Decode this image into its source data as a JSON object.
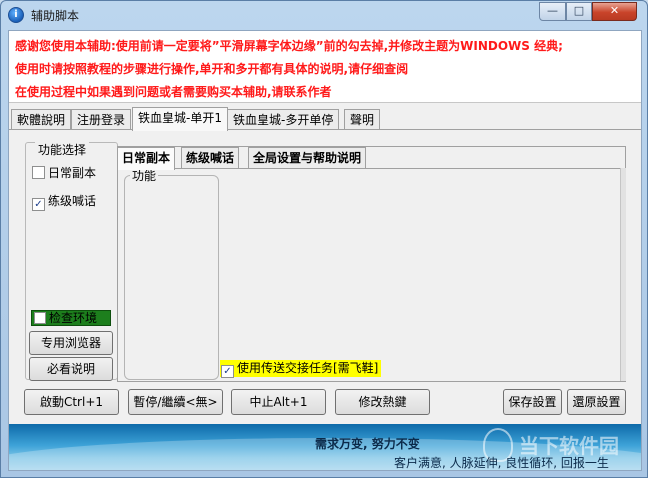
{
  "window": {
    "title": "辅助脚本",
    "icon_name": "app-logo-icon",
    "controls": {
      "minimize": "—",
      "maximize": "□",
      "close": "✕"
    }
  },
  "notice": {
    "color": "#ff1a1a",
    "lines": [
      "感谢您使用本辅助:使用前请一定要将”平滑屏幕字体边缘”前的勾去掉,并修改主题为WINDOWS 经典;",
      "使用时请按照教程的步骤进行操作,单开和多开都有具体的说明,请仔细查阅",
      "在使用过程中如果遇到问题或者需要购买本辅助,请联系作者"
    ]
  },
  "tabs": [
    {
      "label": "軟體說明",
      "active": false
    },
    {
      "label": "注册登录",
      "active": false
    },
    {
      "label": "铁血皇城-单开1",
      "active": true
    },
    {
      "label": "铁血皇城-多开单停",
      "active": false
    },
    {
      "label": "聲明",
      "active": false
    }
  ],
  "function_select": {
    "title": "功能选择",
    "items": [
      {
        "label": "日常副本",
        "checked": false
      },
      {
        "label": "练级喊话",
        "checked": true
      }
    ],
    "env_check": {
      "label": "检查环境",
      "checked": false,
      "background": "#1d7f1d"
    },
    "buttons": {
      "browser": "专用浏览器",
      "help": "必看说明"
    }
  },
  "subtabs": [
    {
      "label": "日常副本",
      "active": true
    },
    {
      "label": "练级喊话",
      "active": false
    },
    {
      "label": "全局设置与帮助说明",
      "active": false
    }
  ],
  "panel": {
    "group_title": "功能",
    "transfer_option": {
      "label": "使用传送交接任务[需飞鞋]",
      "checked": true,
      "background": "#ffff00"
    }
  },
  "bottom_buttons": {
    "start": "啟動Ctrl+1",
    "pause": "暫停/繼續<無>",
    "stop": "中止Alt+1",
    "hotkey": "修改熱鍵",
    "save": "保存設置",
    "restore": "還原設置"
  },
  "footer": {
    "slogan_1": "需求万变, 努力不变",
    "slogan_2": "客户满意, 人脉延伸, 良性循环, 回报一生",
    "watermark": "当下软件园"
  }
}
